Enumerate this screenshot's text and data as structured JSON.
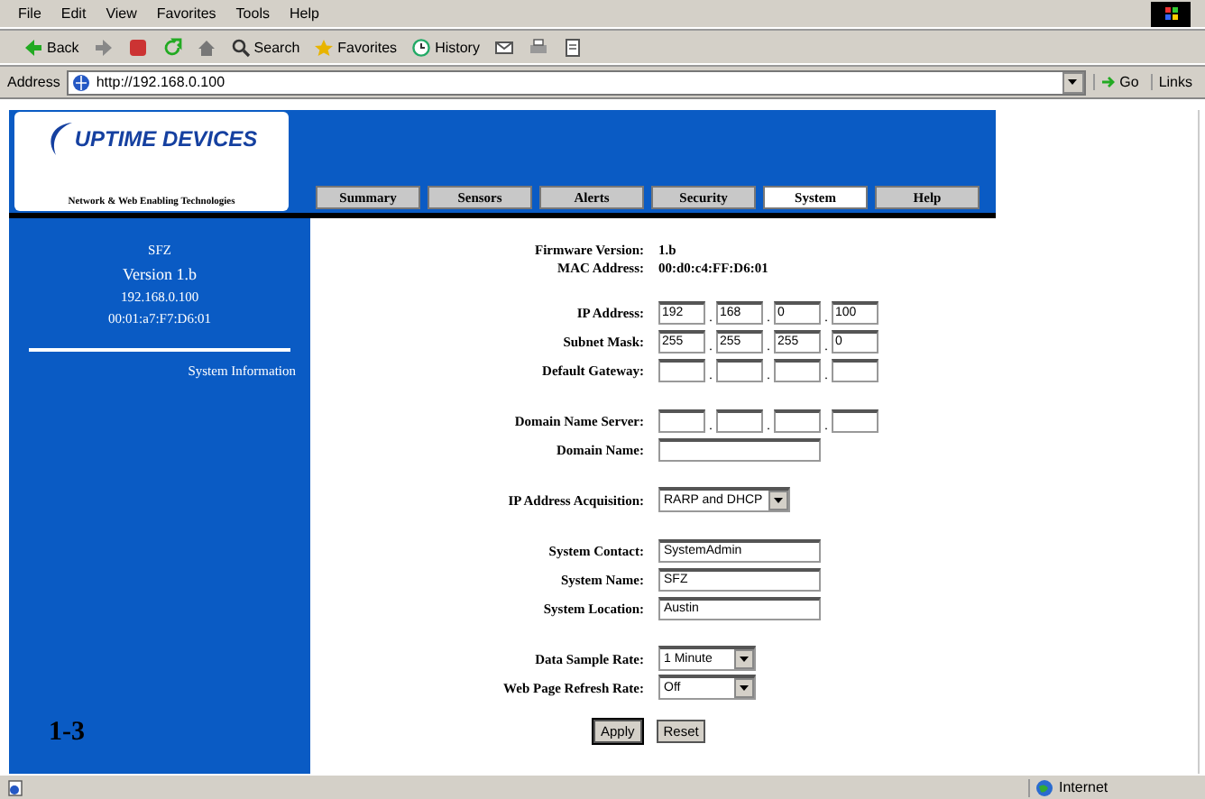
{
  "menu": [
    "File",
    "Edit",
    "View",
    "Favorites",
    "Tools",
    "Help"
  ],
  "toolbar": [
    {
      "label": "Back",
      "kind": "back"
    },
    {
      "kind": "forward"
    },
    {
      "kind": "stop"
    },
    {
      "kind": "refresh"
    },
    {
      "kind": "home"
    },
    {
      "label": "Search",
      "kind": "search"
    },
    {
      "label": "Favorites",
      "kind": "favorites"
    },
    {
      "label": "History",
      "kind": "history"
    },
    {
      "kind": "mail"
    },
    {
      "kind": "print"
    },
    {
      "kind": "edit"
    }
  ],
  "address": {
    "label": "Address",
    "value": "http://192.168.0.100",
    "go": "Go",
    "links": "Links"
  },
  "logo": {
    "name": "UPTIME DEVICES",
    "tagline": "Network & Web Enabling Technologies"
  },
  "tabs": [
    {
      "label": "Summary",
      "selected": false
    },
    {
      "label": "Sensors",
      "selected": false
    },
    {
      "label": "Alerts",
      "selected": false
    },
    {
      "label": "Security",
      "selected": false
    },
    {
      "label": "System",
      "selected": true
    },
    {
      "label": "Help",
      "selected": false
    }
  ],
  "sidebar": {
    "lines": [
      "SFZ",
      "Version 1.b",
      "192.168.0.100",
      "00:01:a7:F7:D6:01"
    ],
    "link": "System Information",
    "page_number": "1-3"
  },
  "form": {
    "groups": [
      [
        {
          "label": "Firmware Version:",
          "kind": "text",
          "value": "1.b"
        },
        {
          "label": "MAC Address:",
          "kind": "text",
          "value": "00:d0:c4:FF:D6:01"
        }
      ],
      [
        {
          "label": "IP Address:",
          "kind": "ip",
          "octets": [
            "192",
            "168",
            "0",
            "100"
          ],
          "separators": [
            ".",
            ".",
            "."
          ]
        },
        {
          "label": "Subnet Mask:",
          "kind": "ip",
          "octets": [
            "255",
            "255",
            "255",
            "0"
          ],
          "separators": [
            ".",
            ".",
            "."
          ]
        },
        {
          "label": "Default Gateway:",
          "kind": "ip",
          "separators": [
            ".",
            ".",
            "."
          ]
        }
      ],
      [
        {
          "label": "Domain Name Server:",
          "kind": "ip",
          "separators": [
            ".",
            ".",
            "."
          ]
        },
        {
          "label": "Domain Name:",
          "kind": "input"
        }
      ],
      [
        {
          "label": "IP Address Acquisition:",
          "kind": "select",
          "value": "RARP and DHCP"
        }
      ],
      [
        {
          "label": "System Contact:",
          "kind": "input",
          "value": "SystemAdmin"
        },
        {
          "label": "System Name:",
          "kind": "input",
          "value": "SFZ"
        },
        {
          "label": "System Location:",
          "kind": "input",
          "value": "Austin"
        }
      ],
      [
        {
          "label": "Data Sample Rate:",
          "kind": "select",
          "value": "1 Minute"
        },
        {
          "label": "Web Page Refresh Rate:",
          "kind": "select",
          "value": "Off"
        }
      ]
    ],
    "buttons": [
      "Apply",
      "Reset"
    ]
  },
  "status_bar": {
    "zone": "Internet"
  }
}
